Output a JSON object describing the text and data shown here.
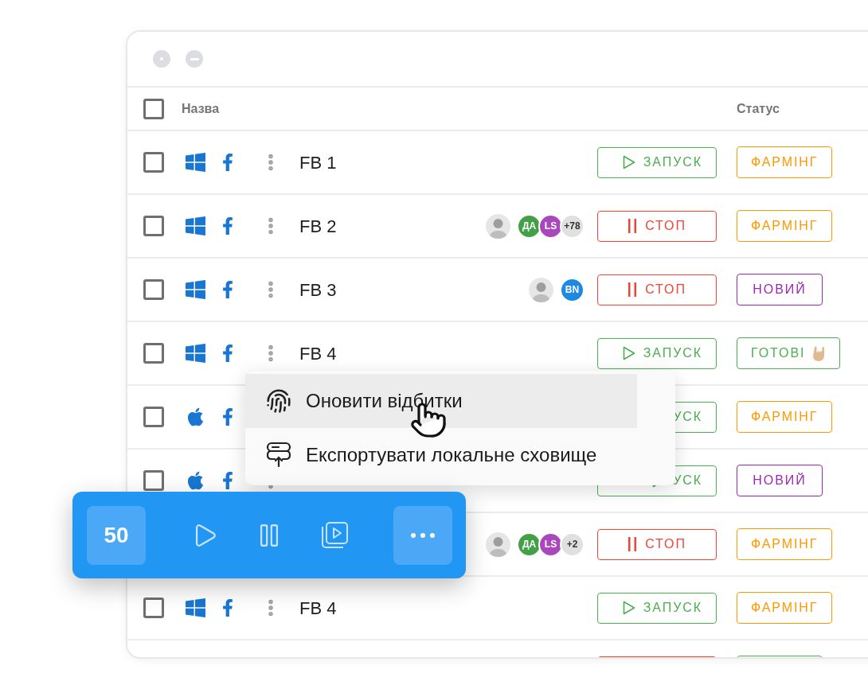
{
  "table": {
    "select_all": {
      "checked": false
    },
    "columns": [
      "Назва",
      "Статус"
    ],
    "rows": [
      {
        "checked": false,
        "kind": "windows",
        "options": true,
        "name": "FB 1",
        "avatars": [],
        "action": {
          "kind": "start",
          "triangle": true,
          "label": "ЗАПУСК"
        },
        "status": {
          "kind": "plain",
          "label": "ФАРМІНГ",
          "color": "#ff9800"
        }
      },
      {
        "checked": false,
        "kind": "windows",
        "options": true,
        "name": "FB 2",
        "avatars": [
          {
            "kind": "photo"
          },
          {
            "kind": "initials",
            "text": "ДА",
            "color": "#43a047"
          },
          {
            "kind": "initials",
            "text": "LS",
            "color": "#ab47bc"
          },
          {
            "kind": "more",
            "text": "+78"
          }
        ],
        "action": {
          "kind": "stop",
          "label": "СТОП"
        },
        "status": {
          "kind": "plain",
          "label": "ФАРМІНГ",
          "color": "#ff9800"
        }
      },
      {
        "checked": false,
        "kind": "windows",
        "options": true,
        "name": "FB 3",
        "avatars": [
          {
            "kind": "photo"
          },
          {
            "kind": "initials",
            "text": "BN",
            "color": "#1e88e5"
          }
        ],
        "action": {
          "kind": "stop",
          "label": "СТОП"
        },
        "status": {
          "kind": "plain",
          "label": "НОВИЙ",
          "color": "#9c27b0"
        }
      },
      {
        "checked": false,
        "kind": "windows",
        "options": true,
        "name": "FB 4",
        "avatars": [],
        "action": {
          "kind": "start",
          "triangle": true,
          "label": "ЗАПУСК"
        },
        "status": {
          "kind": "emoji",
          "label": "ГОТОВІ",
          "color": "#4caf50"
        }
      },
      {
        "checked": false,
        "kind": "apple",
        "options": false,
        "avatars": [],
        "action": {
          "kind": "start",
          "triangle": false,
          "label": "УСК"
        },
        "status": {
          "kind": "plain",
          "label": "ФАРМІНГ",
          "color": "#ff9800"
        }
      },
      {
        "checked": false,
        "kind": "apple",
        "options": true,
        "avatars": [],
        "action": {
          "kind": "start",
          "triangle": true,
          "label": "УСК"
        },
        "status": {
          "kind": "plain",
          "label": "НОВИЙ",
          "color": "#9c27b0"
        }
      },
      {
        "avatars": [
          {
            "kind": "photo"
          },
          {
            "kind": "initials",
            "text": "ДА",
            "color": "#43a047"
          },
          {
            "kind": "initials",
            "text": "LS",
            "color": "#ab47bc"
          },
          {
            "kind": "more",
            "text": "+2"
          }
        ],
        "action": {
          "kind": "stop",
          "label": "СТОП"
        },
        "status": {
          "kind": "plain",
          "label": "ФАРМІНГ",
          "color": "#ff9800"
        }
      },
      {
        "checked": false,
        "kind": "windows",
        "options": true,
        "name": "FB 4",
        "avatars": [],
        "action": {
          "kind": "start",
          "triangle": true,
          "label": "ЗАПУСК"
        },
        "status": {
          "kind": "plain",
          "label": "ФАРМІНГ",
          "color": "#ff9800"
        }
      },
      {
        "avatars": [],
        "action": {
          "kind": "stop"
        },
        "status": {
          "kind": "plain",
          "color": "#4caf50"
        }
      }
    ]
  },
  "context_menu": [
    {
      "label": "Оновити відбитки",
      "selected": true
    },
    {
      "label": "Експортувати локальне сховище",
      "selected": false
    }
  ],
  "toolbar": {
    "count": "50"
  }
}
